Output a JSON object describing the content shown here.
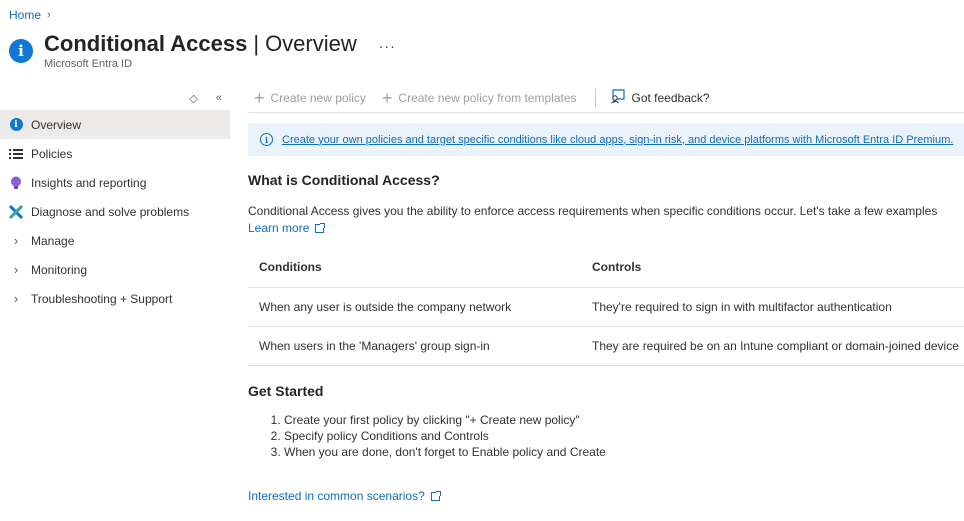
{
  "breadcrumb": {
    "home": "Home",
    "separator": "›"
  },
  "header": {
    "title": "Conditional Access",
    "separator": "|",
    "subtitle": "Overview",
    "more": "···",
    "service": "Microsoft Entra ID",
    "icon": "info-icon"
  },
  "sidebar": {
    "tools": {
      "expand": "◇",
      "collapse": "«"
    },
    "items": [
      {
        "label": "Overview",
        "icon": "info-icon",
        "active": true
      },
      {
        "label": "Policies",
        "icon": "list-icon"
      },
      {
        "label": "Insights and reporting",
        "icon": "bulb-icon"
      },
      {
        "label": "Diagnose and solve problems",
        "icon": "wrench-icon"
      },
      {
        "label": "Manage",
        "icon": "chevron-right-icon"
      },
      {
        "label": "Monitoring",
        "icon": "chevron-right-icon"
      },
      {
        "label": "Troubleshooting + Support",
        "icon": "chevron-right-icon"
      }
    ]
  },
  "toolbar": {
    "create_policy": "Create new policy",
    "create_from_templates": "Create new policy from templates",
    "feedback": "Got feedback?"
  },
  "banner": {
    "text": "Create your own policies and target specific conditions like cloud apps, sign-in risk, and device platforms with Microsoft Entra ID Premium."
  },
  "what_is": {
    "heading": "What is Conditional Access?",
    "description": "Conditional Access gives you the ability to enforce access requirements when specific conditions occur. Let's take a few examples",
    "learn_more": "Learn more"
  },
  "table": {
    "headers": [
      "Conditions",
      "Controls"
    ],
    "rows": [
      [
        "When any user is outside the company network",
        "They're required to sign in with multifactor authentication"
      ],
      [
        "When users in the 'Managers' group sign-in",
        "They are required be on an Intune compliant or domain-joined device"
      ]
    ]
  },
  "get_started": {
    "heading": "Get Started",
    "steps": [
      "Create your first policy by clicking \"+ Create new policy\"",
      "Specify policy Conditions and Controls",
      "When you are done, don't forget to Enable policy and Create"
    ],
    "scenarios_link": "Interested in common scenarios?"
  },
  "colors": {
    "accent": "#0f6cbd",
    "banner_bg": "#eaf3fb",
    "active_bg": "#edebe9"
  }
}
